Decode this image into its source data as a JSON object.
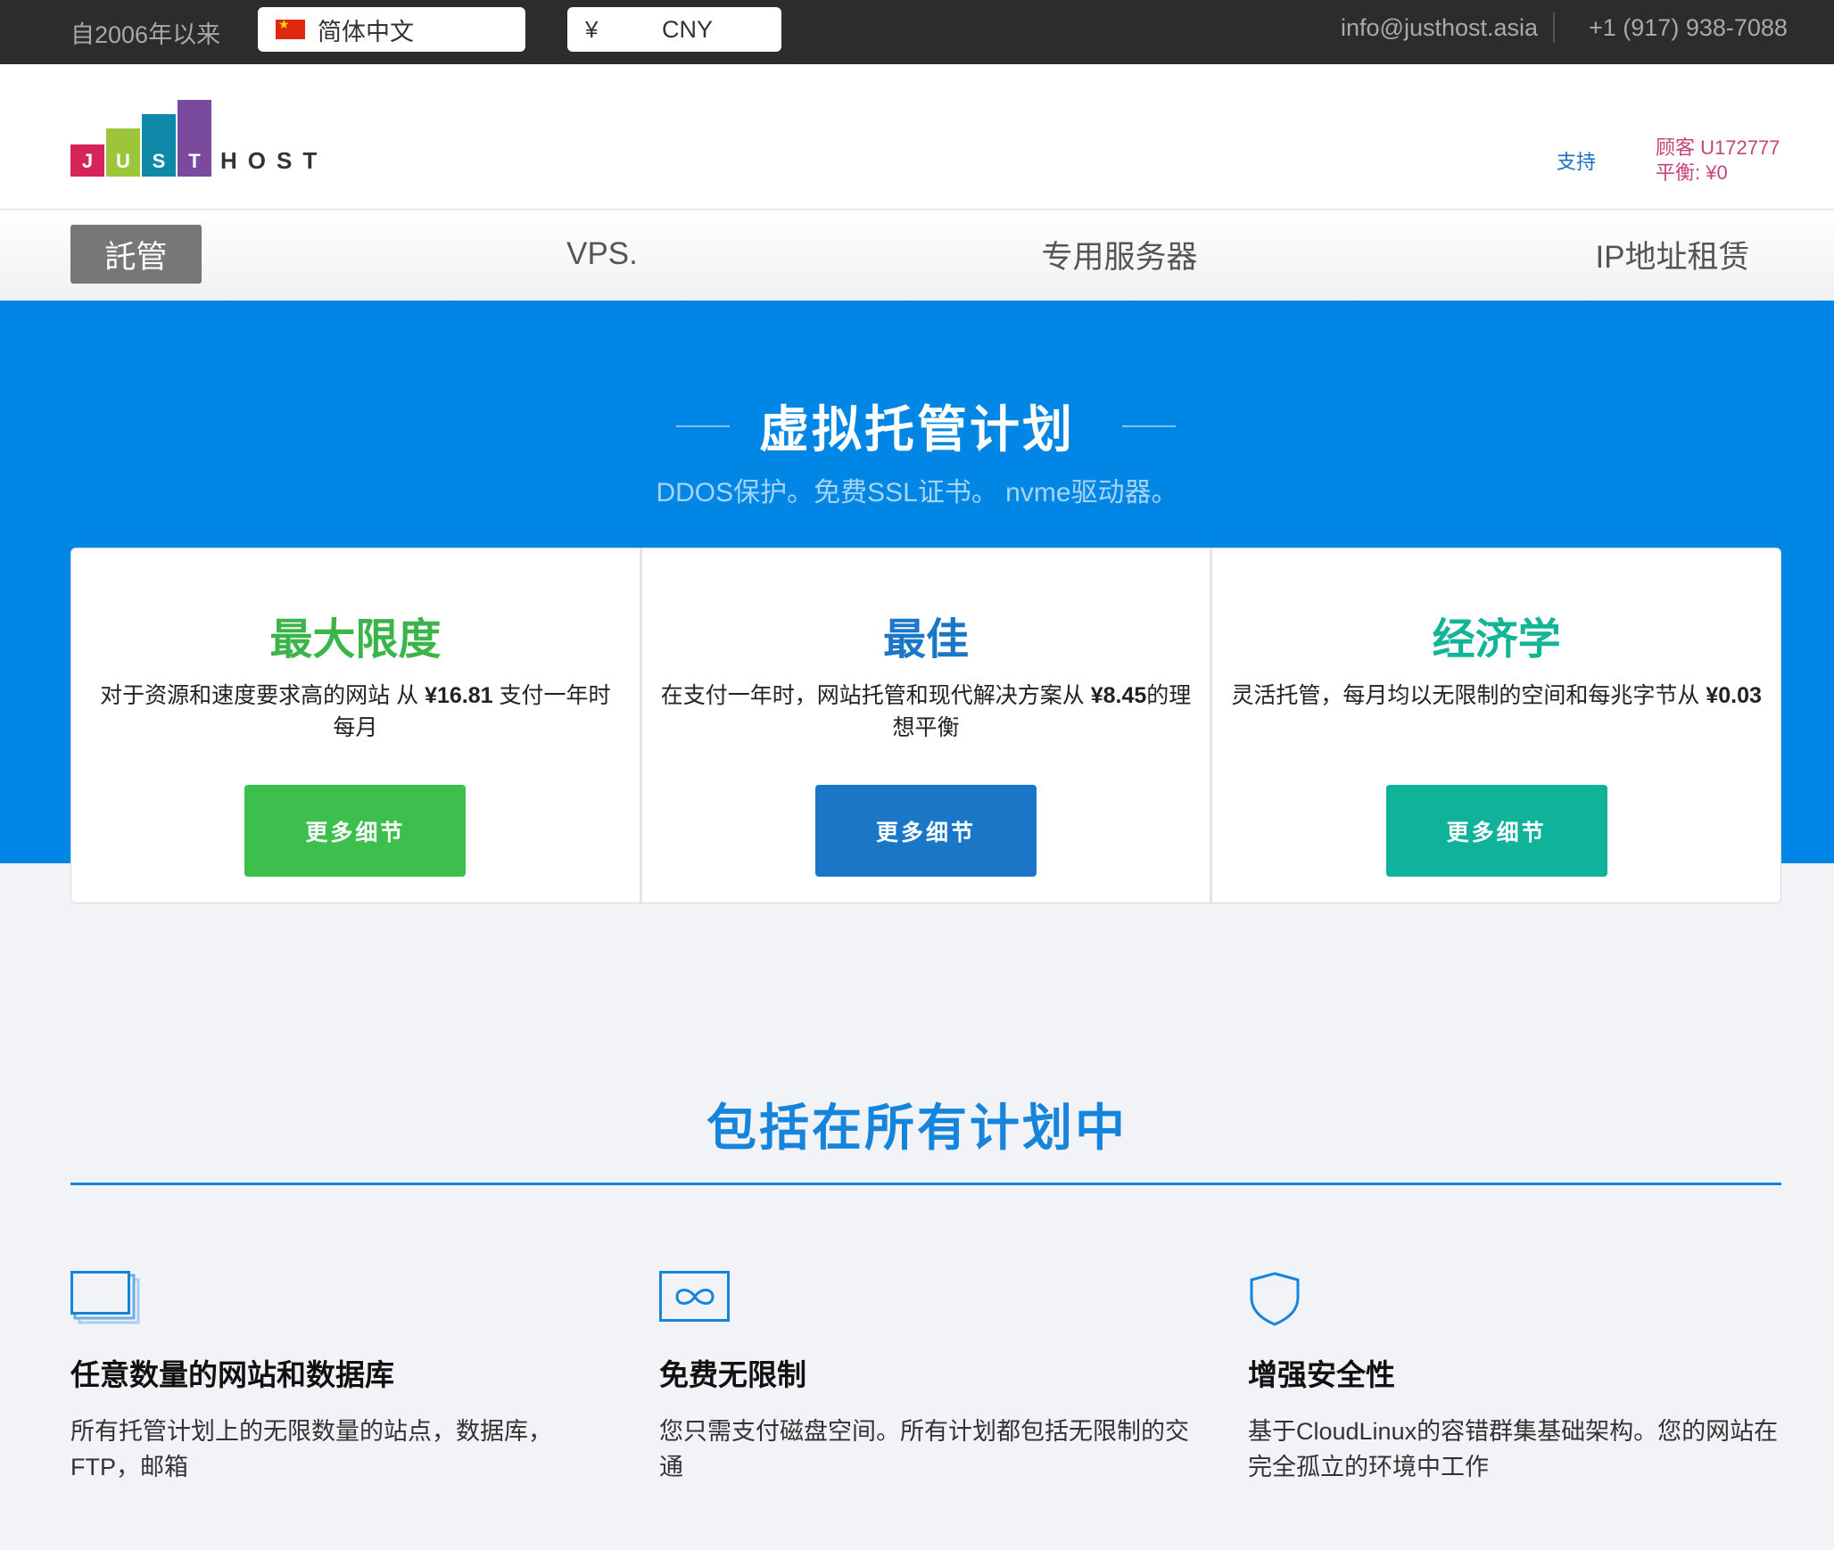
{
  "topbar": {
    "since": "自2006年以来",
    "language": "简体中文",
    "currency_symbol": "¥",
    "currency": "CNY",
    "email": "info@justhost.asia",
    "phone": "+1 (917) 938-7088"
  },
  "logo": {
    "letters": [
      "J",
      "U",
      "S",
      "T"
    ],
    "host": "HOST",
    "colors": [
      "#d4245a",
      "#9cc53a",
      "#0e8aa8",
      "#7a4a9e"
    ]
  },
  "header": {
    "support": "支持",
    "customer": "顾客 U172777",
    "balance": "平衡: ¥0"
  },
  "nav": {
    "items": [
      {
        "label": "託管",
        "active": true
      },
      {
        "label": "VPS.",
        "active": false
      },
      {
        "label": "专用服务器",
        "active": false
      },
      {
        "label": "IP地址租赁",
        "active": false
      }
    ]
  },
  "hero": {
    "title": "虚拟托管计划",
    "subtitle": "DDOS保护。免费SSL证书。 nvme驱动器。"
  },
  "plans": [
    {
      "name": "最大限度",
      "color": "#3bb54a",
      "desc_pre": "对于资源和速度要求高的网站 从 ",
      "price": "¥16.81",
      "desc_post": " 支付一年时每月",
      "button": "更多细节",
      "button_color": "#3cbf4c"
    },
    {
      "name": "最佳",
      "color": "#1a76c7",
      "desc_pre": "在支付一年时，网站托管和现代解决方案从 ",
      "price": "¥8.45",
      "desc_post": "的理想平衡",
      "button": "更多细节",
      "button_color": "#1a76c7"
    },
    {
      "name": "经济学",
      "color": "#13b497",
      "desc_pre": "灵活托管，每月均以无限制的空间和每兆字节从 ",
      "price": "¥0.03",
      "desc_post": "",
      "button": "更多细节",
      "button_color": "#0fb39a"
    }
  ],
  "included": {
    "title": "包括在所有计划中",
    "features": [
      {
        "icon": "stacked-windows-icon",
        "title": "任意数量的网站和数据库",
        "desc": "所有托管计划上的无限数量的站点，数据库，FTP，邮箱"
      },
      {
        "icon": "infinity-icon",
        "title": "免费无限制",
        "desc": "您只需支付磁盘空间。所有计划都包括无限制的交通"
      },
      {
        "icon": "shield-icon",
        "title": "增强安全性",
        "desc": "基于CloudLinux的容错群集基础架构。您的网站在完全孤立的环境中工作"
      }
    ]
  }
}
